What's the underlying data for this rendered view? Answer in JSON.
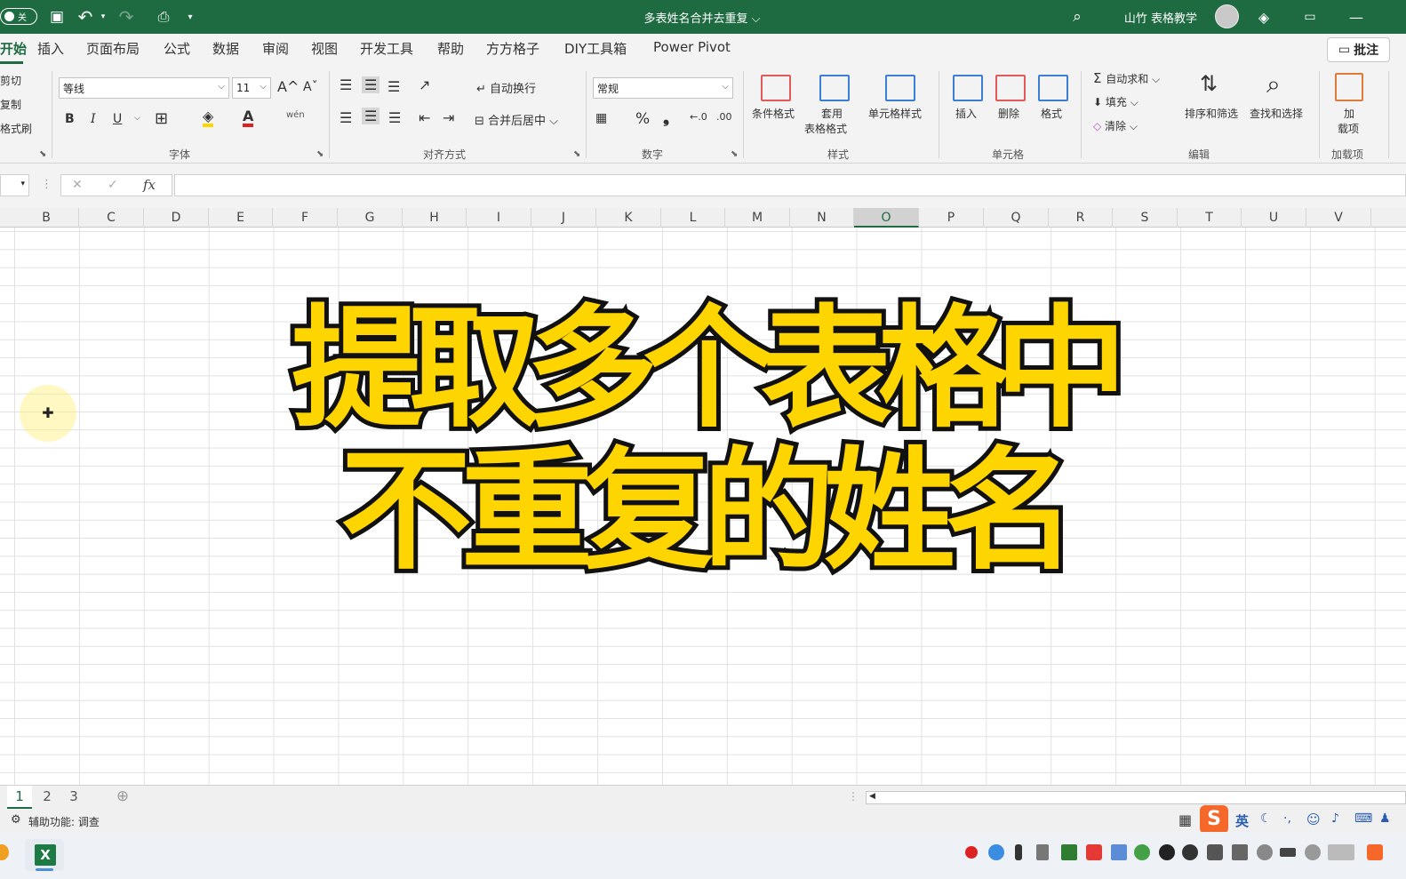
{
  "titlebar": {
    "toggle_label": "关",
    "doc_title": "多表姓名合并去重复 ⌵",
    "user": "山竹 表格教学",
    "undo_icon": "↶",
    "redo_icon": "↷"
  },
  "tabs": [
    "开始",
    "插入",
    "页面布局",
    "公式",
    "数据",
    "审阅",
    "视图",
    "开发工具",
    "帮助",
    "方方格子",
    "DIY工具箱",
    "Power Pivot"
  ],
  "comment_label": "批注",
  "ribbon": {
    "clipboard": {
      "cut": "剪切",
      "copy": "复制",
      "format_painter": "格式刷"
    },
    "font": {
      "name": "等线",
      "size": "11",
      "group": "字体",
      "bold": "B",
      "italic": "I",
      "underline": "U",
      "grow": "A^",
      "shrink": "Aˇ",
      "phonetic": "wén"
    },
    "align": {
      "wrap": "自动换行",
      "merge": "合并后居中",
      "group": "对齐方式"
    },
    "number": {
      "format": "常规",
      "percent": "%",
      "comma": "❟",
      "group": "数字"
    },
    "styles": {
      "cond": "条件格式",
      "table_top": "套用",
      "table_bottom": "表格格式",
      "cell": "单元格样式",
      "group": "样式"
    },
    "cells": {
      "insert": "插入",
      "delete": "删除",
      "format": "格式",
      "group": "单元格"
    },
    "editing": {
      "autosum": "自动求和",
      "fill": "填充",
      "clear": "清除",
      "sort": "排序和筛选",
      "find": "查找和选择",
      "group": "编辑"
    },
    "addins": {
      "top": "加",
      "bottom": "载项",
      "group": "加载项"
    }
  },
  "formula": {
    "fx": "fx",
    "cancel": "✕",
    "enter": "✓"
  },
  "columns": [
    "B",
    "C",
    "D",
    "E",
    "F",
    "G",
    "H",
    "I",
    "J",
    "K",
    "L",
    "M",
    "N",
    "O",
    "P",
    "Q",
    "R",
    "S",
    "T",
    "U",
    "V"
  ],
  "selected_column": "O",
  "headline": {
    "line1": "提取多个表格中",
    "line2": "不重复的姓名"
  },
  "sheets": [
    "1",
    "2",
    "3"
  ],
  "add_sheet": "⊕",
  "status": {
    "accessibility": "辅助功能: 调查",
    "ime": "英"
  }
}
